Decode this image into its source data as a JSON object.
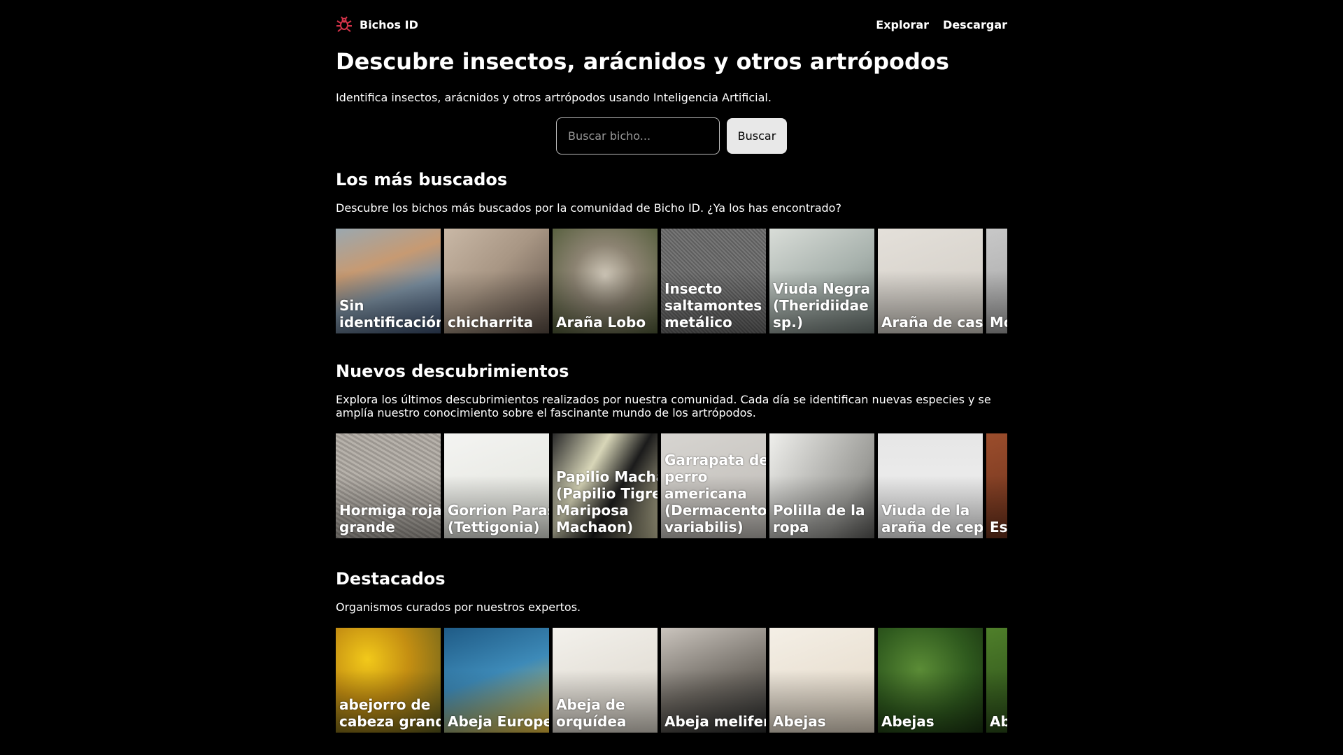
{
  "header": {
    "brand": "Bichos ID",
    "nav": [
      "Explorar",
      "Descargar"
    ]
  },
  "hero": {
    "title": "Descubre insectos, arácnidos y otros artrópodos",
    "lead": "Identifica insectos, arácnidos y otros artrópodos usando Inteligencia Artificial.",
    "search_placeholder": "Buscar bicho...",
    "search_button": "Buscar"
  },
  "sections": [
    {
      "title": "Los más buscados",
      "desc": "Descubre los bichos más buscados por la comunidad de Bicho ID. ¿Ya los has encontrado?",
      "cards": [
        {
          "label": "Sin identificación",
          "bg": "linear-gradient(160deg,#9aa8b0 0%,#c79a72 35%,#7b8fa0 60%,#3b4e6e 100%)"
        },
        {
          "label": "chicharrita",
          "bg": "linear-gradient(135deg,#c9b8a6 0%,#a89684 45%,#5a4d44 100%)"
        },
        {
          "label": "Araña Lobo",
          "bg": "radial-gradient(circle at 50% 45%,#cfc7b8 0%,#8c8372 40%,#4f5a36 100%)"
        },
        {
          "label": "Insecto saltamontes metálico",
          "bg": "repeating-linear-gradient(45deg,#5e5e5e 0 2px,#777 2px 4px)"
        },
        {
          "label": "Viuda Negra (Theridiidae sp.)",
          "bg": "linear-gradient(150deg,#d9ddd8 0%,#a8b2ad 50%,#6c7773 100%)"
        },
        {
          "label": "Araña de casa",
          "bg": "linear-gradient(160deg,#e4e0da 0%,#cfcac2 100%)"
        },
        {
          "label": "Mo (C sp",
          "bg": "linear-gradient(160deg,#c8c8c8 0%,#9a9a9a 100%)"
        }
      ]
    },
    {
      "title": "Nuevos descubrimientos",
      "desc": "Explora los últimos descubrimientos realizados por nuestra comunidad. Cada día se identifican nuevas especies y se amplía nuestro conocimiento sobre el fascinante mundo de los artrópodos.",
      "cards": [
        {
          "label": "Hormiga roja grande",
          "bg": "repeating-linear-gradient(30deg,#9c9791 0 3px,#b7b2ab 3px 6px)"
        },
        {
          "label": "Gorrion Parasito (Tettigonia)",
          "bg": "linear-gradient(160deg,#f4f4f2 0%,#e0e2da 100%)"
        },
        {
          "label": "Papilio Machaon (Papilio Tigre o Mariposa Machaon)",
          "bg": "linear-gradient(120deg,#2a2a2a 0%,#d8d6b8 35%,#1b1b1b 60%,#cfc9a4 100%)"
        },
        {
          "label": "Garrapata de perro americana (Dermacentor variabilis)",
          "bg": "linear-gradient(160deg,#d7d5d1 0%,#bdb9b4 100%)"
        },
        {
          "label": "Polilla de la ropa",
          "bg": "linear-gradient(120deg,#efefec 0%,#9c9c98 70%,#5a5a58 100%)"
        },
        {
          "label": "Viuda de la araña de cepo",
          "bg": "linear-gradient(180deg,#e6e6e6 0%,#f1f1f1 100%)"
        },
        {
          "label": "Es pe",
          "bg": "linear-gradient(160deg,#9b4d2c 0%,#5e2a18 100%)"
        }
      ]
    },
    {
      "title": "Destacados",
      "desc": "Organismos curados por nuestros expertos.",
      "cards": [
        {
          "label": "abejorro de cabeza grande",
          "bg": "radial-gradient(circle at 30% 30%,#f2c91a 0%,#c58f12 40%,#5a5a1e 100%)"
        },
        {
          "label": "Abeja Europea",
          "bg": "linear-gradient(160deg,#1f5b86 0%,#3d8ab8 45%,#f0c23c 100%)"
        },
        {
          "label": "Abeja de orquídea",
          "bg": "linear-gradient(160deg,#f3f1ec 0%,#d9d3c8 100%)"
        },
        {
          "label": "Abeja melifera",
          "bg": "linear-gradient(160deg,#cac4bd 0%,#6f6a63 55%,#2a2b2b 100%)"
        },
        {
          "label": "Abejas",
          "bg": "linear-gradient(160deg,#f4efe6 0%,#e2d6c4 100%)"
        },
        {
          "label": "Abejas",
          "bg": "radial-gradient(circle at 40% 40%,#5b8c36 0%,#2f5a1e 55%,#1a3311 100%)"
        },
        {
          "label": "Ab",
          "bg": "linear-gradient(160deg,#4f7f2a 0%,#1f3d14 100%)"
        }
      ]
    }
  ],
  "colors": {
    "background": "#000000",
    "text": "#ffffff",
    "logo": "#d6334a",
    "button_bg": "#e8e8e8"
  }
}
